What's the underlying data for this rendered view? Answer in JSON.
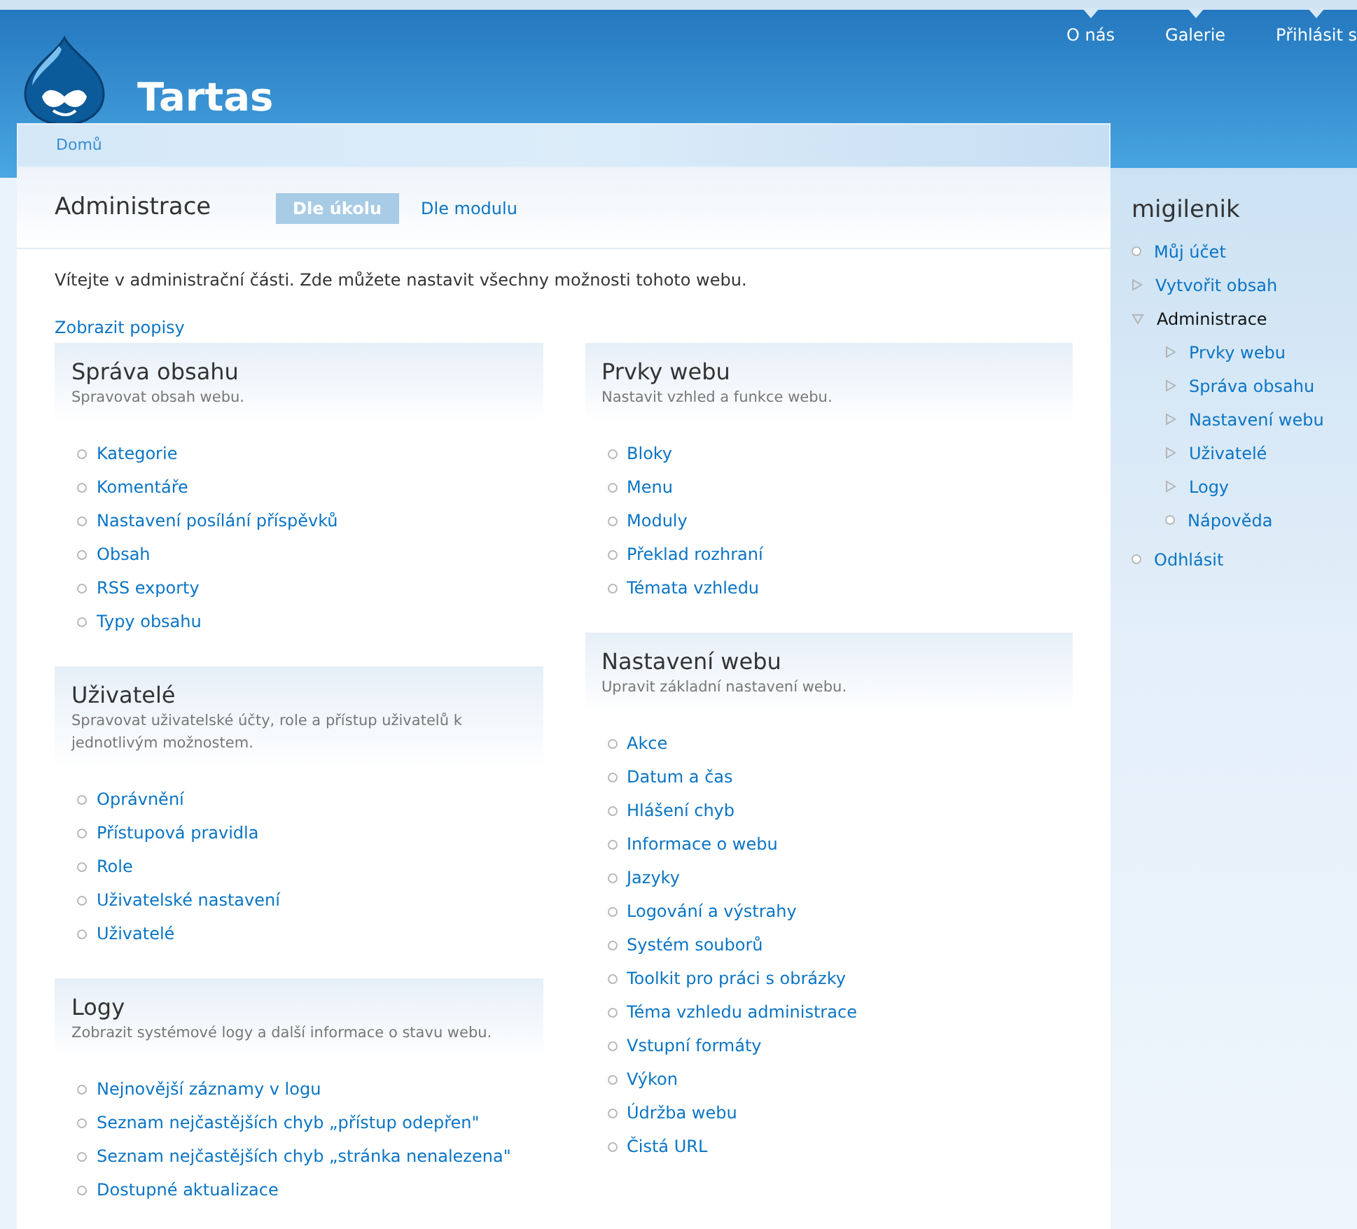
{
  "site": {
    "name": "Tartas",
    "nav": [
      "O nás",
      "Galerie",
      "Přihlásit s"
    ]
  },
  "breadcrumb": [
    "Domů"
  ],
  "page": {
    "title": "Administrace",
    "tabs": [
      {
        "label": "Dle úkolu",
        "selected": true
      },
      {
        "label": "Dle modulu",
        "selected": false
      }
    ],
    "intro": "Vítejte v administrační části. Zde můžete nastavit všechny možnosti tohoto webu.",
    "toggle_link": "Zobrazit popisy"
  },
  "columns": [
    [
      {
        "title": "Správa obsahu",
        "description": "Spravovat obsah webu.",
        "links": [
          "Kategorie",
          "Komentáře",
          "Nastavení posílání příspěvků",
          "Obsah",
          "RSS exporty",
          "Typy obsahu"
        ]
      },
      {
        "title": "Uživatelé",
        "description": "Spravovat uživatelské účty, role a přístup uživatelů k jednotlivým možnostem.",
        "links": [
          "Oprávnění",
          "Přístupová pravidla",
          "Role",
          "Uživatelské nastavení",
          "Uživatelé"
        ]
      },
      {
        "title": "Logy",
        "description": "Zobrazit systémové logy a další informace o stavu webu.",
        "links": [
          "Nejnovější záznamy v logu",
          "Seznam nejčastějších chyb „přístup odepřen\"",
          "Seznam nejčastějších chyb „stránka nenalezena\"",
          "Dostupné aktualizace"
        ]
      }
    ],
    [
      {
        "title": "Prvky webu",
        "description": "Nastavit vzhled a funkce webu.",
        "links": [
          "Bloky",
          "Menu",
          "Moduly",
          "Překlad rozhraní",
          "Témata vzhledu"
        ]
      },
      {
        "title": "Nastavení webu",
        "description": "Upravit základní nastavení webu.",
        "links": [
          "Akce",
          "Datum a čas",
          "Hlášení chyb",
          "Informace o webu",
          "Jazyky",
          "Logování a výstrahy",
          "Systém souborů",
          "Toolkit pro práci s obrázky",
          "Téma vzhledu administrace",
          "Vstupní formáty",
          "Výkon",
          "Údržba webu",
          "Čistá URL"
        ]
      }
    ]
  ],
  "sidebar": {
    "title": "migilenik",
    "items": [
      {
        "label": "Můj účet",
        "kind": "leaf",
        "active": false
      },
      {
        "label": "Vytvořit obsah",
        "kind": "collapsed",
        "active": false
      },
      {
        "label": "Administrace",
        "kind": "expanded",
        "active": true,
        "children": [
          {
            "label": "Prvky webu",
            "kind": "collapsed",
            "active": false
          },
          {
            "label": "Správa obsahu",
            "kind": "collapsed",
            "active": false
          },
          {
            "label": "Nastavení webu",
            "kind": "collapsed",
            "active": false
          },
          {
            "label": "Uživatelé",
            "kind": "collapsed",
            "active": false
          },
          {
            "label": "Logy",
            "kind": "collapsed",
            "active": false
          },
          {
            "label": "Nápověda",
            "kind": "leaf",
            "active": false
          }
        ]
      },
      {
        "label": "Odhlásit",
        "kind": "leaf",
        "active": false
      }
    ]
  }
}
